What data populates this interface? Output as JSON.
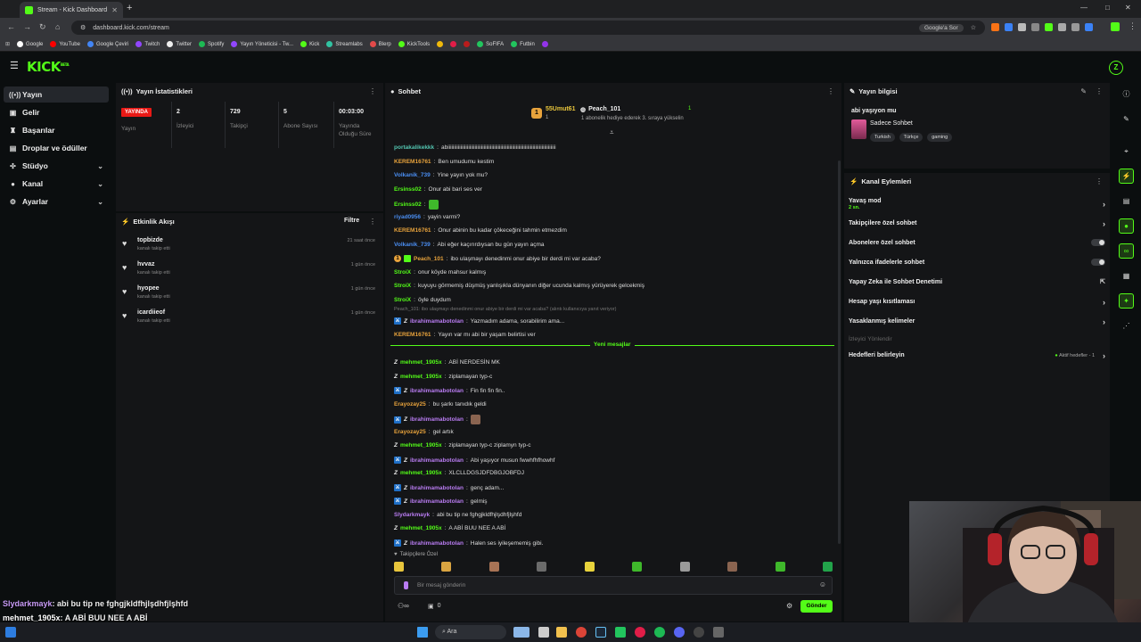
{
  "browser": {
    "tab_title": "Stream - Kick Dashboard",
    "url": "dashboard.kick.com/stream",
    "google_btn": "Google'a Sor",
    "bookmarks": [
      "Google",
      "YouTube",
      "Google Çeviri",
      "Twitch",
      "Twitter",
      "Spotify",
      "Yayın Yöneticisi - Tw...",
      "Kick",
      "Streamlabs",
      "Blerp",
      "KickTools",
      "SoFIFA",
      "Futbin"
    ]
  },
  "brand": {
    "logo": "KICK",
    "logo_sup": "BETA",
    "avatar_letter": "Z"
  },
  "sidebar": {
    "items": [
      {
        "label": "Yayın",
        "icon": "broadcast-icon"
      },
      {
        "label": "Gelir",
        "icon": "wallet-icon"
      },
      {
        "label": "Başarılar",
        "icon": "trophy-icon"
      },
      {
        "label": "Droplar ve ödüller",
        "icon": "gift-icon"
      },
      {
        "label": "Stüdyo",
        "icon": "studio-icon"
      },
      {
        "label": "Kanal",
        "icon": "user-icon"
      },
      {
        "label": "Ayarlar",
        "icon": "gear-icon"
      }
    ]
  },
  "stats": {
    "title": "Yayın İstatistikleri",
    "live_badge": "YAYINDA",
    "stream_label": "Yayın",
    "viewers": "2",
    "viewers_label": "İzleyici",
    "followers": "729",
    "followers_label": "Takipçi",
    "subs": "5",
    "subs_label": "Abone Sayısı",
    "duration": "00:03:00",
    "duration_label": "Yayında Olduğu Süre"
  },
  "activity": {
    "title": "Etkinlik Akışı",
    "filter": "Filtre",
    "events": [
      {
        "name": "topbizde",
        "sub": "kanalı takip etti",
        "time": "21 saat önce"
      },
      {
        "name": "hvvaz",
        "sub": "kanalı takip etti",
        "time": "1 gün önce"
      },
      {
        "name": "hyopee",
        "sub": "kanalı takip etti",
        "time": "1 gün önce"
      },
      {
        "name": "icardiieof",
        "sub": "kanalı takip etti",
        "time": "1 gün önce"
      }
    ]
  },
  "chat": {
    "title": "Sohbet",
    "top_gifter": "55Umut61",
    "top_gifter_count": "1",
    "gifter2": "Peach_101",
    "gifter2_count": "1",
    "gift_hint": "1 abonelik hediye ederek 3. sıraya yükselin",
    "new_messages": "Yeni mesajlar",
    "reply_hint": "Peach_101: ibo ulaşmayı denedinmi onur abiye bir derdi mi var acaba? (alıntı kullanıcıya yanıt veriyor)",
    "followers_only": "Takipçilere Özel",
    "input_placeholder": "Bir mesaj gönderin",
    "send": "Gönder",
    "points": "0",
    "messages": [
      {
        "user": "portakalikekkk",
        "text": "abiiiiiiiiiiiiiiiiiiiiiiiiiiiiiiiiiiiiiiiiiiiiiiiiiiiiiiiiiiiiiiiiiiiiiiiiiiiiiiiiiiii",
        "color": "#53c4b0",
        "badges": ""
      },
      {
        "user": "KEREM16761",
        "text": "Ben umudumu kestim",
        "color": "#e8a33c",
        "badges": ""
      },
      {
        "user": "Volkanik_739",
        "text": "Yine yayın yok mu?",
        "color": "#4a8df0",
        "badges": ""
      },
      {
        "user": "Ersinss02",
        "text": "Onur abi bari ses ver",
        "color": "#53fc18",
        "badges": ""
      },
      {
        "user": "Ersinss02",
        "text": "",
        "color": "#53fc18",
        "badges": "",
        "emote": "#3fb82b"
      },
      {
        "user": "riyad0956",
        "text": "yayin varmi?",
        "color": "#4a8df0",
        "badges": ""
      },
      {
        "user": "KEREM16761",
        "text": "Onur abinin bu kadar çökeceğini tahmin etmezdim",
        "color": "#e8a33c",
        "badges": ""
      },
      {
        "user": "Volkanik_739",
        "text": "Abi eğer kaçırırdıysan bu gün yayın açma",
        "color": "#4a8df0",
        "badges": ""
      },
      {
        "user": "Peach_101",
        "text": "ibo ulaşmayı denedinmi onur abiye bir derdi mi var acaba?",
        "color": "#e8a33c",
        "badges": "gift"
      },
      {
        "user": "StroiX",
        "text": "onur köyde mahsur kalmış",
        "color": "#53fc18",
        "badges": ""
      },
      {
        "user": "StroiX",
        "text": "kuyuyu görmemiş düşmüş yanlışıkla dünyanın diğer ucunda kalmış yürüyerek gelcekmiş",
        "color": "#53fc18",
        "badges": ""
      },
      {
        "user": "StroiX",
        "text": "öyle duydum",
        "color": "#53fc18",
        "badges": ""
      },
      {
        "user": "ibrahimamabotolan",
        "text": "Yazmadım adama, sorabilirim ama...",
        "color": "#b97cf2",
        "badges": "mod"
      },
      {
        "user": "KEREM16761",
        "text": "Yayın var mı abi bir yaşam belirtisi ver",
        "color": "#e8a33c",
        "badges": ""
      },
      {
        "user": "mehmet_1905x",
        "text": "ABİ NERDESİN MK",
        "color": "#53fc18",
        "badges": "z"
      },
      {
        "user": "mehmet_1905x",
        "text": "ziplamayan typ-c",
        "color": "#53fc18",
        "badges": "z"
      },
      {
        "user": "ibrahimamabotolan",
        "text": "Fin fin fin fin..",
        "color": "#b97cf2",
        "badges": "mod"
      },
      {
        "user": "Erayozay25",
        "text": "bu şarkı tanıdık geldi",
        "color": "#e8a33c",
        "badges": ""
      },
      {
        "user": "ibrahimamabotolan",
        "text": "",
        "color": "#b97cf2",
        "badges": "mod",
        "emote": "#8a6450"
      },
      {
        "user": "Erayozay25",
        "text": "gel artık",
        "color": "#e8a33c",
        "badges": ""
      },
      {
        "user": "mehmet_1905x",
        "text": "ziplamayan typ-c ziplamyn typ-c",
        "color": "#53fc18",
        "badges": "z"
      },
      {
        "user": "ibrahimamabotolan",
        "text": "Abi yaşıyor musun fwwhfhfhowhf",
        "color": "#b97cf2",
        "badges": "mod"
      },
      {
        "user": "mehmet_1905x",
        "text": "XLCLLDGSJDFDBGJOBFDJ",
        "color": "#53fc18",
        "badges": "z"
      },
      {
        "user": "ibrahimamabotolan",
        "text": "genç adam...",
        "color": "#b97cf2",
        "badges": "mod"
      },
      {
        "user": "ibrahimamabotolan",
        "text": "gelmiş",
        "color": "#b97cf2",
        "badges": "mod"
      },
      {
        "user": "Slydarkmayk",
        "text": "abi bu tip ne fghgjkldfhjlşdhfjlşhfd",
        "color": "#b97cf2",
        "badges": ""
      },
      {
        "user": "mehmet_1905x",
        "text": "A ABİ BUU NEE A ABİ",
        "color": "#53fc18",
        "badges": "z"
      },
      {
        "user": "ibrahimamabotolan",
        "text": "Halen ses iyileşememiş gibi.",
        "color": "#b97cf2",
        "badges": "mod"
      }
    ]
  },
  "stream_info": {
    "title": "Yayın bilgisi",
    "stream_title": "abi yaşıyon mu",
    "category": "Sadece Sohbet",
    "tags": [
      "Turkish",
      "Türkçe",
      "gaming"
    ]
  },
  "channel_actions": {
    "title": "Kanal Eylemleri",
    "slow_mode": "Yavaş mod",
    "slow_mode_value": "2 sn.",
    "items": [
      "Takipçilere özel sohbet",
      "Abonelere özel sohbet",
      "Yalnızca ifadelerle sohbet",
      "Yapay Zeka ile Sohbet Denetimi",
      "Hesap yaşı kısıtlaması",
      "Yasaklanmış kelimeler"
    ],
    "section": "İzleyici Yönlendir",
    "goals": "Hedefleri belirleyin",
    "goals_status": "Aktif hedefler - 1"
  },
  "overlay": [
    {
      "user": "Slydarkmayk",
      "text": ": abi bu tip ne fghgjkldfhjlşdhfjlşhfd"
    },
    {
      "user": "mehmet_1905x",
      "text": ": A ABİ BUU NEE A ABİ"
    },
    {
      "user": "ibrahimamabotolan",
      "text": ": Halen ses iyileşememiş gibi."
    }
  ],
  "taskbar": {
    "search": "Ara"
  },
  "colors": {
    "accent": "#53fc18",
    "live": "#e91916",
    "bg": "#0b0e0f",
    "panel": "#141517"
  }
}
